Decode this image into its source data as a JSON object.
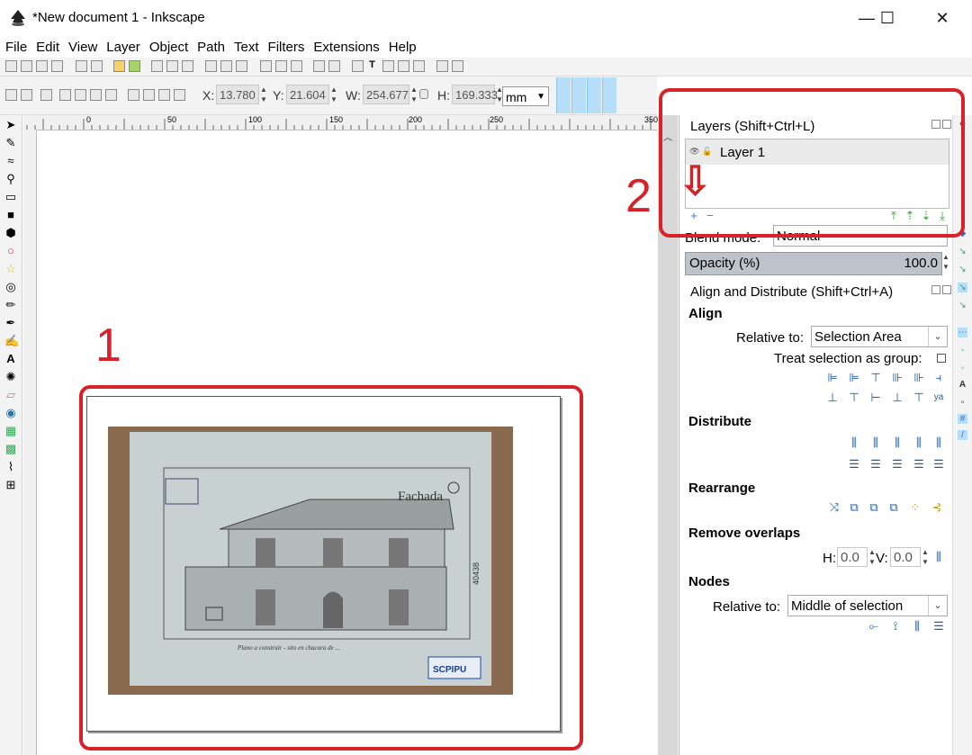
{
  "window": {
    "title": "*New document 1 - Inkscape",
    "minimize": "—",
    "maximize": "☐",
    "close": "✕"
  },
  "menu": [
    "File",
    "Edit",
    "View",
    "Layer",
    "Object",
    "Path",
    "Text",
    "Filters",
    "Extensions",
    "Help"
  ],
  "controls": {
    "x_label": "X:",
    "x_value": "13.780",
    "y_label": "Y:",
    "y_value": "21.604",
    "w_label": "W:",
    "w_value": "254.677",
    "h_label": "H:",
    "h_value": "169.333",
    "unit": "mm"
  },
  "ruler_labels": [
    "0",
    "50",
    "100",
    "150",
    "200",
    "250",
    "350"
  ],
  "layers_panel": {
    "title": "Layers (Shift+Ctrl+L)",
    "layer_name": "Layer 1",
    "blend_label": "Blend mode:",
    "blend_value": "Normal",
    "opacity_label": "Opacity (%)",
    "opacity_value": "100.0"
  },
  "align_panel": {
    "title": "Align and Distribute (Shift+Ctrl+A)",
    "align_heading": "Align",
    "relative_to_label": "Relative to:",
    "relative_to_value": "Selection Area",
    "treat_group_label": "Treat selection as group:",
    "distribute_heading": "Distribute",
    "rearrange_heading": "Rearrange",
    "remove_overlaps_heading": "Remove overlaps",
    "h_label": "H:",
    "h_value": "0.0",
    "v_label": "V:",
    "v_value": "0.0",
    "nodes_heading": "Nodes",
    "nodes_relative_label": "Relative to:",
    "nodes_relative_value": "Middle of selection"
  },
  "drawing": {
    "title_text": "Fachada",
    "stamp_text": "SCPIPU",
    "side_number": "40438",
    "caption": "Plano a construir - sito en chacara de ..."
  },
  "annotations": {
    "one": "1",
    "two": "2",
    "arrow": "⇩"
  },
  "colors": {
    "annotation_red": "#d7222a",
    "snap_blue": "#b7def9"
  }
}
